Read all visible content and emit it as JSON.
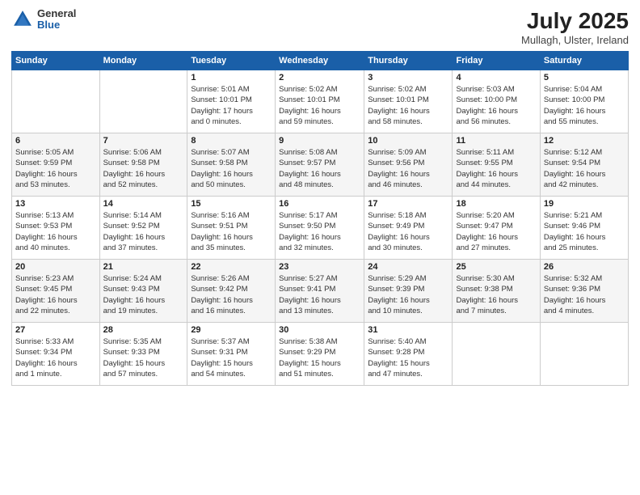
{
  "header": {
    "logo": {
      "general": "General",
      "blue": "Blue"
    },
    "title": "July 2025",
    "location": "Mullagh, Ulster, Ireland"
  },
  "weekdays": [
    "Sunday",
    "Monday",
    "Tuesday",
    "Wednesday",
    "Thursday",
    "Friday",
    "Saturday"
  ],
  "weeks": [
    [
      {
        "day": "",
        "info": ""
      },
      {
        "day": "",
        "info": ""
      },
      {
        "day": "1",
        "info": "Sunrise: 5:01 AM\nSunset: 10:01 PM\nDaylight: 17 hours\nand 0 minutes."
      },
      {
        "day": "2",
        "info": "Sunrise: 5:02 AM\nSunset: 10:01 PM\nDaylight: 16 hours\nand 59 minutes."
      },
      {
        "day": "3",
        "info": "Sunrise: 5:02 AM\nSunset: 10:01 PM\nDaylight: 16 hours\nand 58 minutes."
      },
      {
        "day": "4",
        "info": "Sunrise: 5:03 AM\nSunset: 10:00 PM\nDaylight: 16 hours\nand 56 minutes."
      },
      {
        "day": "5",
        "info": "Sunrise: 5:04 AM\nSunset: 10:00 PM\nDaylight: 16 hours\nand 55 minutes."
      }
    ],
    [
      {
        "day": "6",
        "info": "Sunrise: 5:05 AM\nSunset: 9:59 PM\nDaylight: 16 hours\nand 53 minutes."
      },
      {
        "day": "7",
        "info": "Sunrise: 5:06 AM\nSunset: 9:58 PM\nDaylight: 16 hours\nand 52 minutes."
      },
      {
        "day": "8",
        "info": "Sunrise: 5:07 AM\nSunset: 9:58 PM\nDaylight: 16 hours\nand 50 minutes."
      },
      {
        "day": "9",
        "info": "Sunrise: 5:08 AM\nSunset: 9:57 PM\nDaylight: 16 hours\nand 48 minutes."
      },
      {
        "day": "10",
        "info": "Sunrise: 5:09 AM\nSunset: 9:56 PM\nDaylight: 16 hours\nand 46 minutes."
      },
      {
        "day": "11",
        "info": "Sunrise: 5:11 AM\nSunset: 9:55 PM\nDaylight: 16 hours\nand 44 minutes."
      },
      {
        "day": "12",
        "info": "Sunrise: 5:12 AM\nSunset: 9:54 PM\nDaylight: 16 hours\nand 42 minutes."
      }
    ],
    [
      {
        "day": "13",
        "info": "Sunrise: 5:13 AM\nSunset: 9:53 PM\nDaylight: 16 hours\nand 40 minutes."
      },
      {
        "day": "14",
        "info": "Sunrise: 5:14 AM\nSunset: 9:52 PM\nDaylight: 16 hours\nand 37 minutes."
      },
      {
        "day": "15",
        "info": "Sunrise: 5:16 AM\nSunset: 9:51 PM\nDaylight: 16 hours\nand 35 minutes."
      },
      {
        "day": "16",
        "info": "Sunrise: 5:17 AM\nSunset: 9:50 PM\nDaylight: 16 hours\nand 32 minutes."
      },
      {
        "day": "17",
        "info": "Sunrise: 5:18 AM\nSunset: 9:49 PM\nDaylight: 16 hours\nand 30 minutes."
      },
      {
        "day": "18",
        "info": "Sunrise: 5:20 AM\nSunset: 9:47 PM\nDaylight: 16 hours\nand 27 minutes."
      },
      {
        "day": "19",
        "info": "Sunrise: 5:21 AM\nSunset: 9:46 PM\nDaylight: 16 hours\nand 25 minutes."
      }
    ],
    [
      {
        "day": "20",
        "info": "Sunrise: 5:23 AM\nSunset: 9:45 PM\nDaylight: 16 hours\nand 22 minutes."
      },
      {
        "day": "21",
        "info": "Sunrise: 5:24 AM\nSunset: 9:43 PM\nDaylight: 16 hours\nand 19 minutes."
      },
      {
        "day": "22",
        "info": "Sunrise: 5:26 AM\nSunset: 9:42 PM\nDaylight: 16 hours\nand 16 minutes."
      },
      {
        "day": "23",
        "info": "Sunrise: 5:27 AM\nSunset: 9:41 PM\nDaylight: 16 hours\nand 13 minutes."
      },
      {
        "day": "24",
        "info": "Sunrise: 5:29 AM\nSunset: 9:39 PM\nDaylight: 16 hours\nand 10 minutes."
      },
      {
        "day": "25",
        "info": "Sunrise: 5:30 AM\nSunset: 9:38 PM\nDaylight: 16 hours\nand 7 minutes."
      },
      {
        "day": "26",
        "info": "Sunrise: 5:32 AM\nSunset: 9:36 PM\nDaylight: 16 hours\nand 4 minutes."
      }
    ],
    [
      {
        "day": "27",
        "info": "Sunrise: 5:33 AM\nSunset: 9:34 PM\nDaylight: 16 hours\nand 1 minute."
      },
      {
        "day": "28",
        "info": "Sunrise: 5:35 AM\nSunset: 9:33 PM\nDaylight: 15 hours\nand 57 minutes."
      },
      {
        "day": "29",
        "info": "Sunrise: 5:37 AM\nSunset: 9:31 PM\nDaylight: 15 hours\nand 54 minutes."
      },
      {
        "day": "30",
        "info": "Sunrise: 5:38 AM\nSunset: 9:29 PM\nDaylight: 15 hours\nand 51 minutes."
      },
      {
        "day": "31",
        "info": "Sunrise: 5:40 AM\nSunset: 9:28 PM\nDaylight: 15 hours\nand 47 minutes."
      },
      {
        "day": "",
        "info": ""
      },
      {
        "day": "",
        "info": ""
      }
    ]
  ]
}
